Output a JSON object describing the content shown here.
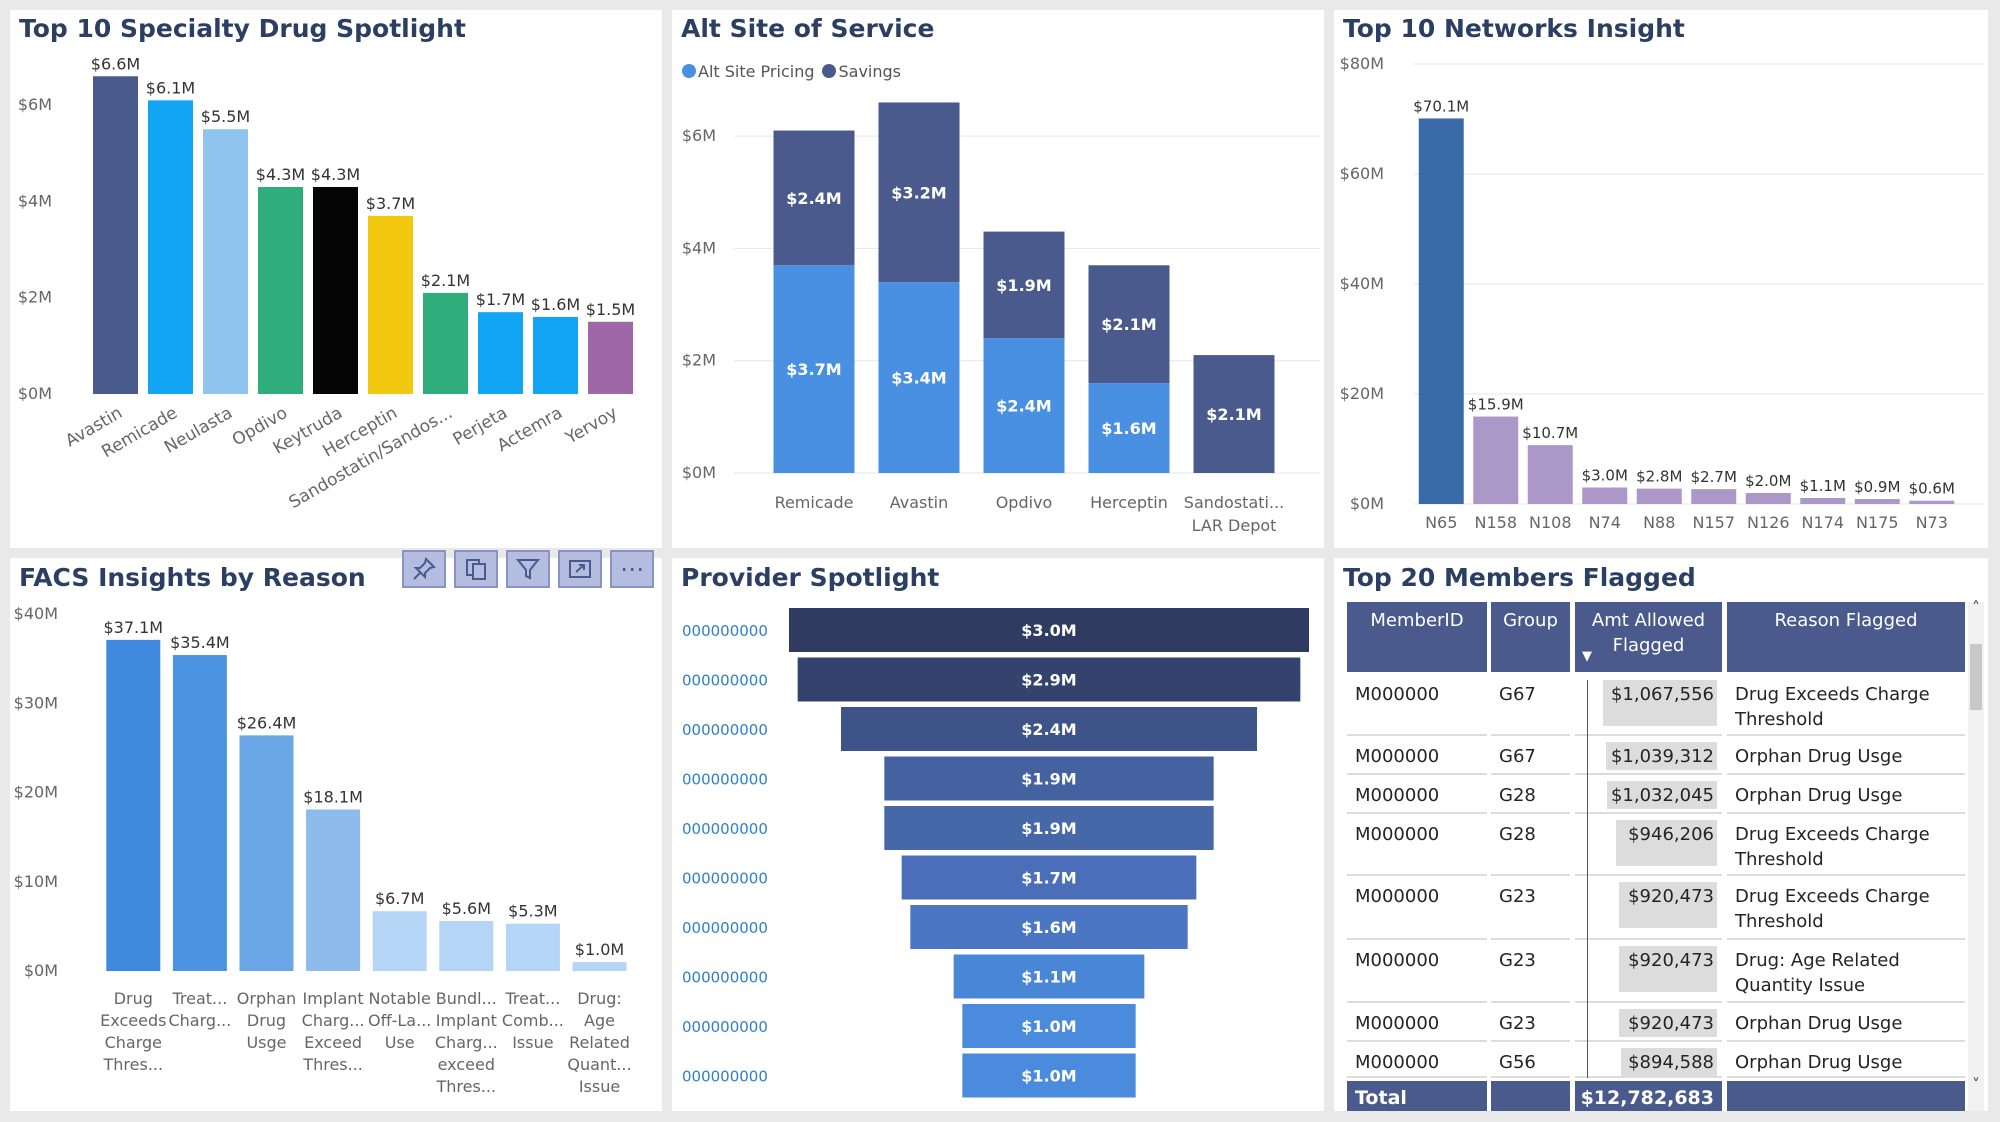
{
  "panels": {
    "drugs": {
      "title": "Top 10 Specialty Drug Spotlight"
    },
    "alt_site": {
      "title": "Alt Site of Service",
      "legend": [
        {
          "label": "Alt Site Pricing",
          "color": "#4a90e2"
        },
        {
          "label": "Savings",
          "color": "#4a5a8c"
        }
      ]
    },
    "networks": {
      "title": "Top 10 Networks Insight"
    },
    "facs": {
      "title": "FACS Insights by Reason"
    },
    "provider": {
      "title": "Provider Spotlight"
    },
    "members": {
      "title": "Top 20 Members Flagged"
    }
  },
  "toolbar": {
    "items": [
      {
        "icon": "pin-icon"
      },
      {
        "icon": "copy-icon"
      },
      {
        "icon": "filter-icon"
      },
      {
        "icon": "focus-mode-icon"
      },
      {
        "icon": "more-options-icon"
      }
    ],
    "more_label": "⋯"
  },
  "chart_data": [
    {
      "id": "drugs",
      "type": "bar",
      "title": "Top 10 Specialty Drug Spotlight",
      "categories": [
        "Avastin",
        "Remicade",
        "Neulasta",
        "Opdivo",
        "Keytruda",
        "Herceptin",
        "Sandostatin/Sandos...",
        "Perjeta",
        "Actemra",
        "Yervoy"
      ],
      "values": [
        6.6,
        6.1,
        5.5,
        4.3,
        4.3,
        3.7,
        2.1,
        1.7,
        1.6,
        1.5
      ],
      "labels": [
        "$6.6M",
        "$6.1M",
        "$5.5M",
        "$4.3M",
        "$4.3M",
        "$3.7M",
        "$2.1M",
        "$1.7M",
        "$1.6M",
        "$1.5M"
      ],
      "colors": [
        "#4a5a8c",
        "#12a5f4",
        "#8fc4ef",
        "#2fae7c",
        "#050505",
        "#f2c811",
        "#2fae7c",
        "#12a5f4",
        "#12a5f4",
        "#a067a8"
      ],
      "ylim": [
        0,
        7
      ],
      "yticks": [
        {
          "v": 0,
          "label": "$0M"
        },
        {
          "v": 2,
          "label": "$2M"
        },
        {
          "v": 4,
          "label": "$4M"
        },
        {
          "v": 6,
          "label": "$6M"
        }
      ],
      "grid": false
    },
    {
      "id": "alt_site",
      "type": "bar",
      "title": "Alt Site of Service",
      "categories": [
        [
          "Remicade"
        ],
        [
          "Avastin"
        ],
        [
          "Opdivo"
        ],
        [
          "Herceptin"
        ],
        [
          "Sandostati...",
          "LAR Depot"
        ]
      ],
      "series": [
        {
          "name": "Alt Site Pricing",
          "color": "#4a90e2",
          "values": [
            3.7,
            3.4,
            2.4,
            1.6,
            0
          ],
          "labels": [
            "$3.7M",
            "$3.4M",
            "$2.4M",
            "$1.6M",
            ""
          ]
        },
        {
          "name": "Savings",
          "color": "#4a5a8c",
          "values": [
            2.4,
            3.2,
            1.9,
            2.1,
            2.1
          ],
          "labels": [
            "$2.4M",
            "$3.2M",
            "$1.9M",
            "$2.1M",
            "$2.1M"
          ]
        }
      ],
      "stacked": true,
      "ylim": [
        0,
        7
      ],
      "yticks": [
        {
          "v": 0,
          "label": "$0M"
        },
        {
          "v": 2,
          "label": "$2M"
        },
        {
          "v": 4,
          "label": "$4M"
        },
        {
          "v": 6,
          "label": "$6M"
        }
      ],
      "grid": true,
      "legend": "top-left"
    },
    {
      "id": "networks",
      "type": "bar",
      "title": "Top 10 Networks Insight",
      "categories": [
        "N65",
        "N158",
        "N108",
        "N74",
        "N88",
        "N157",
        "N126",
        "N174",
        "N175",
        "N73"
      ],
      "values": [
        70.1,
        15.9,
        10.7,
        3.0,
        2.8,
        2.7,
        2.0,
        1.1,
        0.9,
        0.6
      ],
      "labels": [
        "$70.1M",
        "$15.9M",
        "$10.7M",
        "$3.0M",
        "$2.8M",
        "$2.7M",
        "$2.0M",
        "$1.1M",
        "$0.9M",
        "$0.6M"
      ],
      "colors": [
        "#3a6aa8",
        "#ab98c9",
        "#ab98c9",
        "#ab98c9",
        "#ab98c9",
        "#ab98c9",
        "#ab98c9",
        "#ab98c9",
        "#ab98c9",
        "#ab98c9"
      ],
      "ylim": [
        0,
        80
      ],
      "yticks": [
        {
          "v": 0,
          "label": "$0M"
        },
        {
          "v": 20,
          "label": "$20M"
        },
        {
          "v": 40,
          "label": "$40M"
        },
        {
          "v": 60,
          "label": "$60M"
        },
        {
          "v": 80,
          "label": "$80M"
        }
      ],
      "grid": true
    },
    {
      "id": "facs",
      "type": "bar",
      "title": "FACS Insights by Reason",
      "categories": [
        [
          "Drug",
          "Exceeds",
          "Charge",
          "Thres..."
        ],
        [
          "Treat...",
          "Charg..."
        ],
        [
          "Orphan",
          "Drug",
          "Usge"
        ],
        [
          "Implant",
          "Charg...",
          "Exceed",
          "Thres..."
        ],
        [
          "Notable",
          "Off-La...",
          "Use"
        ],
        [
          "Bundl...",
          "Implant",
          "Charg...",
          "exceed",
          "Thres..."
        ],
        [
          "Treat...",
          "Comb...",
          "Issue"
        ],
        [
          "Drug:",
          "Age",
          "Related",
          "Quant...",
          "Issue"
        ]
      ],
      "values": [
        37.1,
        35.4,
        26.4,
        18.1,
        6.7,
        5.6,
        5.3,
        1.0
      ],
      "labels": [
        "$37.1M",
        "$35.4M",
        "$26.4M",
        "$18.1M",
        "$6.7M",
        "$5.6M",
        "$5.3M",
        "$1.0M"
      ],
      "colors": [
        "#3f8ade",
        "#4b92e0",
        "#6aa6e5",
        "#8dbcec",
        "#b4d5f5",
        "#b4d5f5",
        "#b4d5f5",
        "#b4d5f5"
      ],
      "ylim": [
        0,
        40
      ],
      "yticks": [
        {
          "v": 0,
          "label": "$0M"
        },
        {
          "v": 10,
          "label": "$10M"
        },
        {
          "v": 20,
          "label": "$20M"
        },
        {
          "v": 30,
          "label": "$30M"
        },
        {
          "v": 40,
          "label": "$40M"
        }
      ],
      "grid": false
    },
    {
      "id": "provider",
      "type": "bar",
      "title": "Provider Spotlight",
      "orientation": "funnel",
      "categories": [
        "000000000",
        "000000000",
        "000000000",
        "000000000",
        "000000000",
        "000000000",
        "000000000",
        "000000000",
        "000000000",
        "000000000"
      ],
      "values": [
        3.0,
        2.9,
        2.4,
        1.9,
        1.9,
        1.7,
        1.6,
        1.1,
        1.0,
        1.0
      ],
      "labels": [
        "$3.0M",
        "$2.9M",
        "$2.4M",
        "$1.9M",
        "$1.9M",
        "$1.7M",
        "$1.6M",
        "$1.1M",
        "$1.0M",
        "$1.0M"
      ],
      "colors": [
        "#2f3b60",
        "#34436d",
        "#3e5488",
        "#4462a0",
        "#4667a8",
        "#4a6fb8",
        "#4b76c4",
        "#4a86d6",
        "#4a8bdd",
        "#4a8bdd"
      ]
    }
  ],
  "members_table": {
    "headers": [
      {
        "lines": [
          "MemberID"
        ]
      },
      {
        "lines": [
          "Group"
        ]
      },
      {
        "lines": [
          "Amt Allowed",
          "Flagged"
        ]
      },
      {
        "lines": [
          "Reason Flagged"
        ]
      }
    ],
    "sort_indicator": "▼",
    "rows": [
      {
        "member": "M000000",
        "group": "G67",
        "amount": "$1,067,556",
        "amount_value": 1067556,
        "reason": [
          "Drug Exceeds Charge",
          "Threshold"
        ]
      },
      {
        "member": "M000000",
        "group": "G67",
        "amount": "$1,039,312",
        "amount_value": 1039312,
        "reason": [
          "Orphan Drug Usge"
        ]
      },
      {
        "member": "M000000",
        "group": "G28",
        "amount": "$1,032,045",
        "amount_value": 1032045,
        "reason": [
          "Orphan Drug Usge"
        ]
      },
      {
        "member": "M000000",
        "group": "G28",
        "amount": "$946,206",
        "amount_value": 946206,
        "reason": [
          "Drug Exceeds Charge",
          "Threshold"
        ]
      },
      {
        "member": "M000000",
        "group": "G23",
        "amount": "$920,473",
        "amount_value": 920473,
        "reason": [
          "Drug Exceeds Charge",
          "Threshold"
        ]
      },
      {
        "member": "M000000",
        "group": "G23",
        "amount": "$920,473",
        "amount_value": 920473,
        "reason": [
          "Drug: Age Related",
          "Quantity Issue"
        ]
      },
      {
        "member": "M000000",
        "group": "G23",
        "amount": "$920,473",
        "amount_value": 920473,
        "reason": [
          "Orphan Drug Usge"
        ]
      },
      {
        "member": "M000000",
        "group": "G56",
        "amount": "$894,588",
        "amount_value": 894588,
        "reason": [
          "Orphan Drug Usge"
        ]
      }
    ],
    "total": {
      "label": "Total",
      "amount": "$12,782,683"
    },
    "scroll_up": "˄",
    "scroll_down": "˅"
  }
}
